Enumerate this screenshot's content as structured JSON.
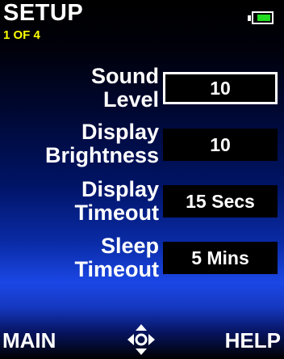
{
  "header": {
    "title": "SETUP",
    "page_indicator": "1 OF 4",
    "battery_icon": "battery-icon",
    "battery_level": 0.8
  },
  "settings": [
    {
      "label_line1": "Sound",
      "label_line2": "Level",
      "value": "10",
      "selected": true
    },
    {
      "label_line1": "Display",
      "label_line2": "Brightness",
      "value": "10",
      "selected": false
    },
    {
      "label_line1": "Display",
      "label_line2": "Timeout",
      "value": "15 Secs",
      "selected": false
    },
    {
      "label_line1": "Sleep",
      "label_line2": "Timeout",
      "value": "5 Mins",
      "selected": false
    }
  ],
  "footer": {
    "left_label": "MAIN",
    "right_label": "HELP",
    "center_icon": "directional-pad-icon"
  },
  "colors": {
    "page_indicator": "#ffff00",
    "battery_fill": "#22dd22",
    "value_box": "#000000",
    "text": "#ffffff"
  }
}
